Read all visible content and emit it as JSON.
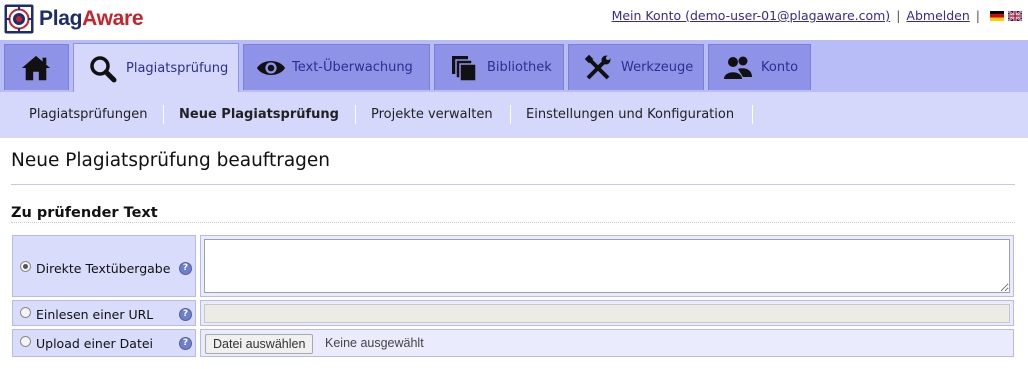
{
  "brand": {
    "name_part1": "Plag",
    "name_part2": "Aware",
    "colors": {
      "navy": "#1d2d6b",
      "red": "#c8232c"
    }
  },
  "header": {
    "account_link": "Mein Konto (demo-user-01@plagaware.com)",
    "separator": "|",
    "logout_link": "Abmelden",
    "languages": [
      "de-flag-icon",
      "uk-flag-icon"
    ]
  },
  "main_nav": {
    "tabs": [
      {
        "label": "",
        "icon": "home-icon"
      },
      {
        "label": "Plagiatsprüfung",
        "icon": "search-icon",
        "active": true
      },
      {
        "label": "Text-Überwachung",
        "icon": "eye-icon"
      },
      {
        "label": "Bibliothek",
        "icon": "library-icon"
      },
      {
        "label": "Werkzeuge",
        "icon": "tools-icon"
      },
      {
        "label": "Konto",
        "icon": "users-icon"
      }
    ],
    "colors": {
      "bar": "#b9bdf7",
      "tab": "#8f93e8",
      "active_tab": "#d5d8fb",
      "text": "#2d2e8e"
    }
  },
  "sub_nav": {
    "items": [
      {
        "label": "Plagiatsprüfungen"
      },
      {
        "label": "Neue Plagiatsprüfung",
        "active": true
      },
      {
        "label": "Projekte verwalten"
      },
      {
        "label": "Einstellungen und Konfiguration"
      }
    ]
  },
  "page": {
    "title": "Neue Plagiatsprüfung beauftragen",
    "section_title": "Zu prüfender Text"
  },
  "form": {
    "options": [
      {
        "label": "Direkte Textübergabe",
        "selected": true,
        "help": "?"
      },
      {
        "label": "Einlesen einer URL",
        "selected": false,
        "help": "?"
      },
      {
        "label": "Upload einer Datei",
        "selected": false,
        "help": "?"
      }
    ],
    "text_value": "",
    "url_value": "",
    "file_button": "Datei auswählen",
    "file_status": "Keine ausgewählt"
  }
}
